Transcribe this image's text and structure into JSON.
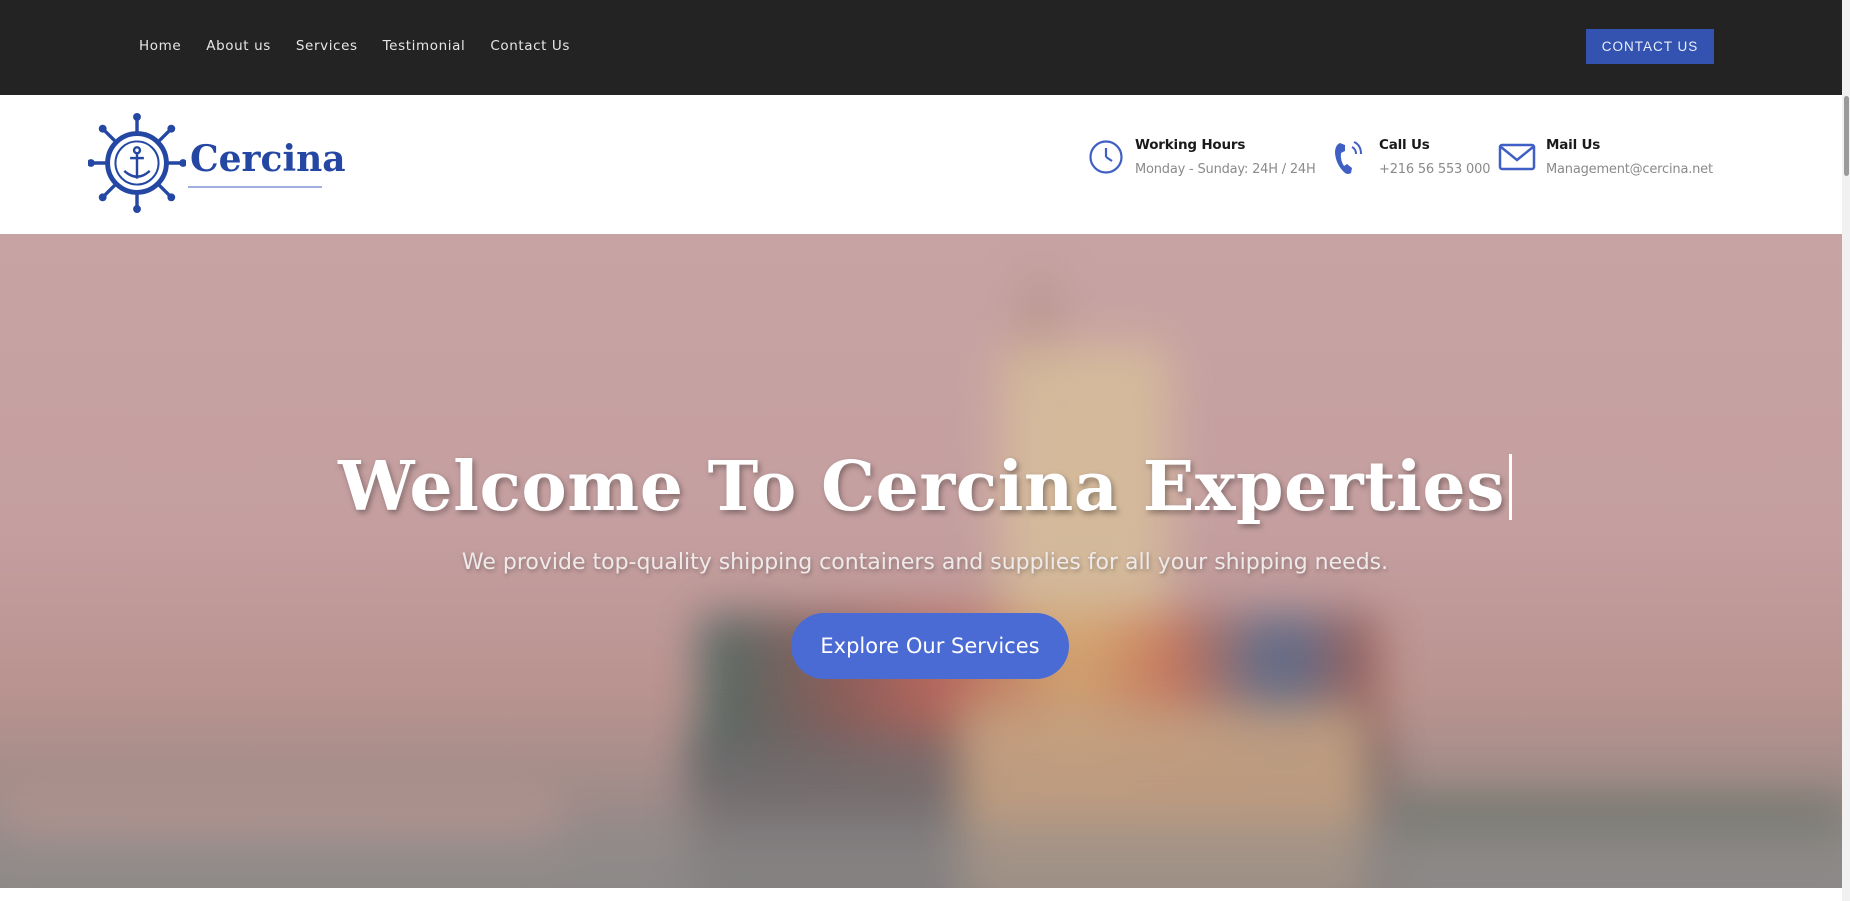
{
  "nav": {
    "items": [
      {
        "label": "Home"
      },
      {
        "label": "About us"
      },
      {
        "label": "Services"
      },
      {
        "label": "Testimonial"
      },
      {
        "label": "Contact Us"
      }
    ],
    "contact_button": "CONTACT US"
  },
  "brand": {
    "name": "Cercina",
    "logo_icon": "ship-wheel-anchor-icon"
  },
  "info": {
    "hours": {
      "title": "Working Hours",
      "value": "Monday - Sunday: 24H / 24H",
      "icon": "clock-icon"
    },
    "call": {
      "title": "Call Us",
      "value": "+216 56 553 000",
      "icon": "phone-icon"
    },
    "mail": {
      "title": "Mail Us",
      "value": "Management@cercina.net",
      "icon": "envelope-icon"
    }
  },
  "hero": {
    "title": "Welcome To Cercina Experties",
    "subtitle": "We provide top-quality shipping containers and supplies for all your shipping needs.",
    "button": "Explore Our Services"
  },
  "colors": {
    "topbar": "#232323",
    "accent": "#3453b0",
    "hero_button": "#4a6ad4",
    "brand": "#2547a4"
  }
}
